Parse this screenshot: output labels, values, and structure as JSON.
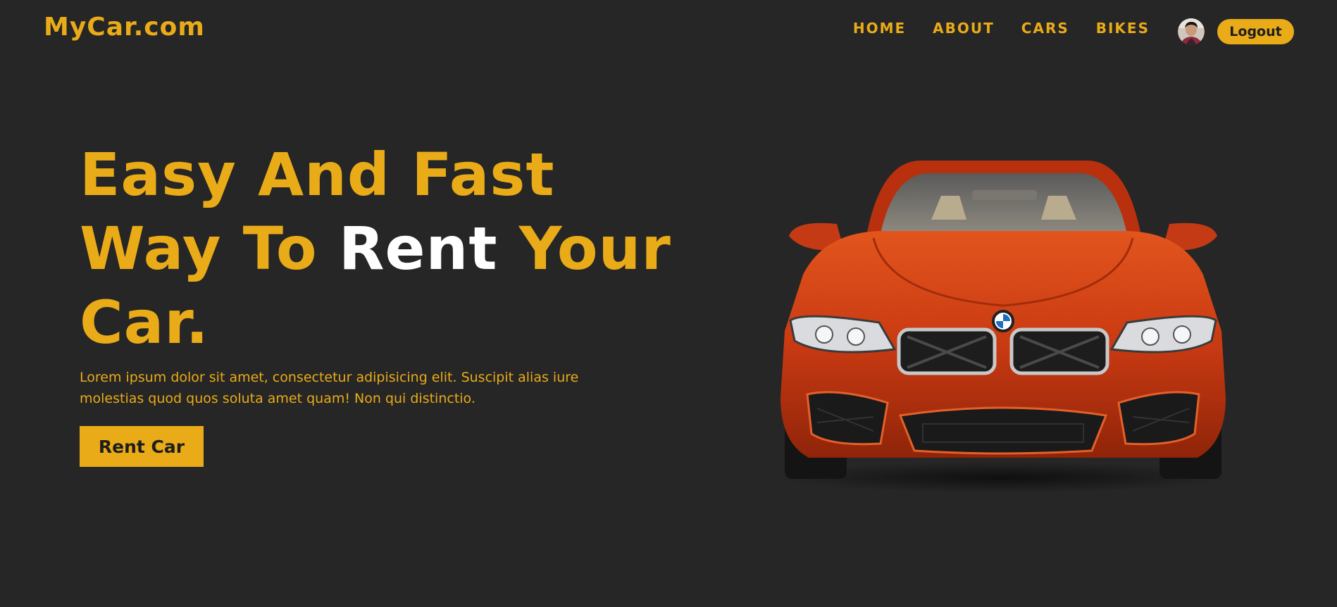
{
  "header": {
    "logo": "MyCar.com",
    "nav": [
      "HOME",
      "ABOUT",
      "CARS",
      "BIKES"
    ],
    "logout_label": "Logout"
  },
  "hero": {
    "headline": {
      "line1": "Easy And Fast",
      "line2_pre": "Way To ",
      "line2_white": "Rent",
      "line2_post": " Your",
      "line3": "Car."
    },
    "description": "Lorem ipsum dolor sit amet, consectetur adipisicing elit. Suscipit alias iure molestias quod quos soluta amet quam! Non qui distinctio.",
    "cta_label": "Rent Car"
  },
  "colors": {
    "background": "#262626",
    "accent": "#e9ab18",
    "highlight": "#ffffff",
    "car_body": "#c93a12"
  },
  "icons": {
    "avatar": "user-avatar-photo",
    "hero_image": "red-bmw-front-view"
  }
}
